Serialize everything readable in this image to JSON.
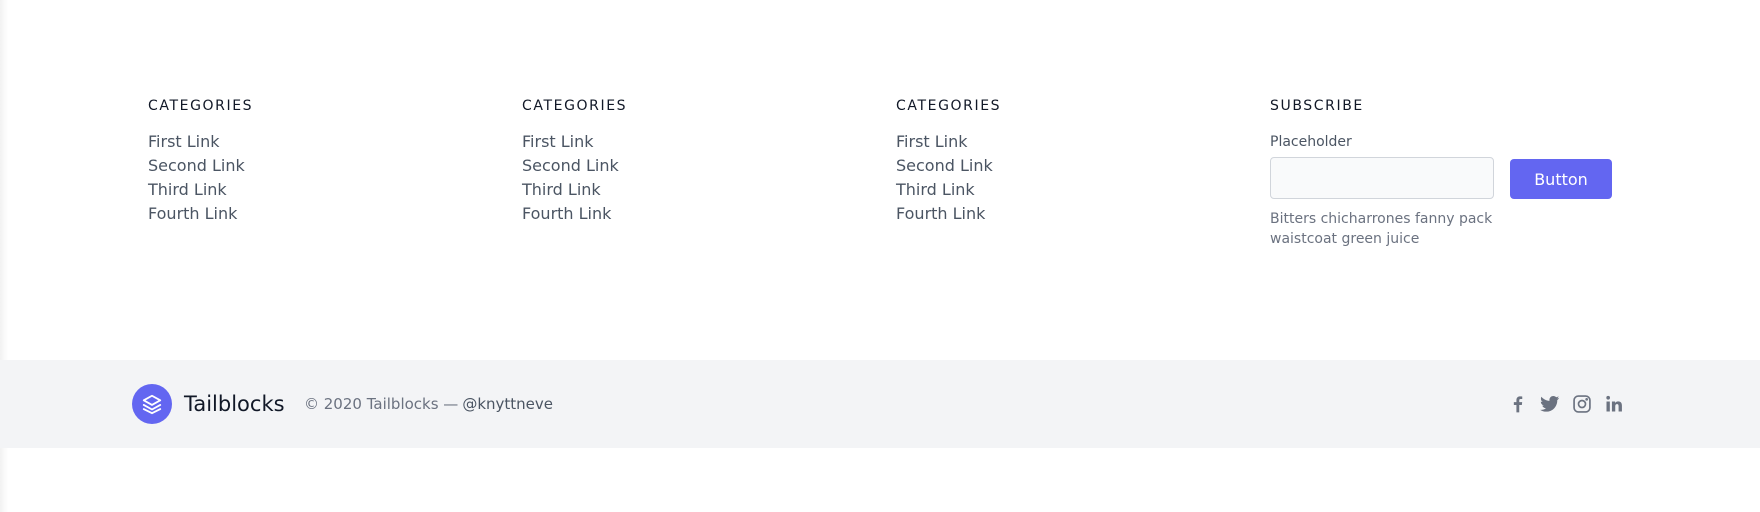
{
  "link_columns": [
    {
      "title": "CATEGORIES",
      "links": [
        "First Link",
        "Second Link",
        "Third Link",
        "Fourth Link"
      ]
    },
    {
      "title": "CATEGORIES",
      "links": [
        "First Link",
        "Second Link",
        "Third Link",
        "Fourth Link"
      ]
    },
    {
      "title": "CATEGORIES",
      "links": [
        "First Link",
        "Second Link",
        "Third Link",
        "Fourth Link"
      ]
    }
  ],
  "subscribe": {
    "title": "SUBSCRIBE",
    "label": "Placeholder",
    "input_value": "",
    "button_label": "Button",
    "help_text": "Bitters chicharrones fanny pack waistcoat green juice"
  },
  "footer": {
    "brand_name": "Tailblocks",
    "logo_icon": "stacked-layers-icon",
    "copyright": "© 2020 Tailblocks —",
    "handle": "@knyttneve",
    "socials": [
      "facebook-icon",
      "twitter-icon",
      "instagram-icon",
      "linkedin-icon"
    ]
  },
  "colors": {
    "accent": "#6366f1",
    "bottom_bar_bg": "#f3f4f6",
    "heading": "#111827",
    "text": "#4b5563",
    "muted": "#6b7280"
  }
}
